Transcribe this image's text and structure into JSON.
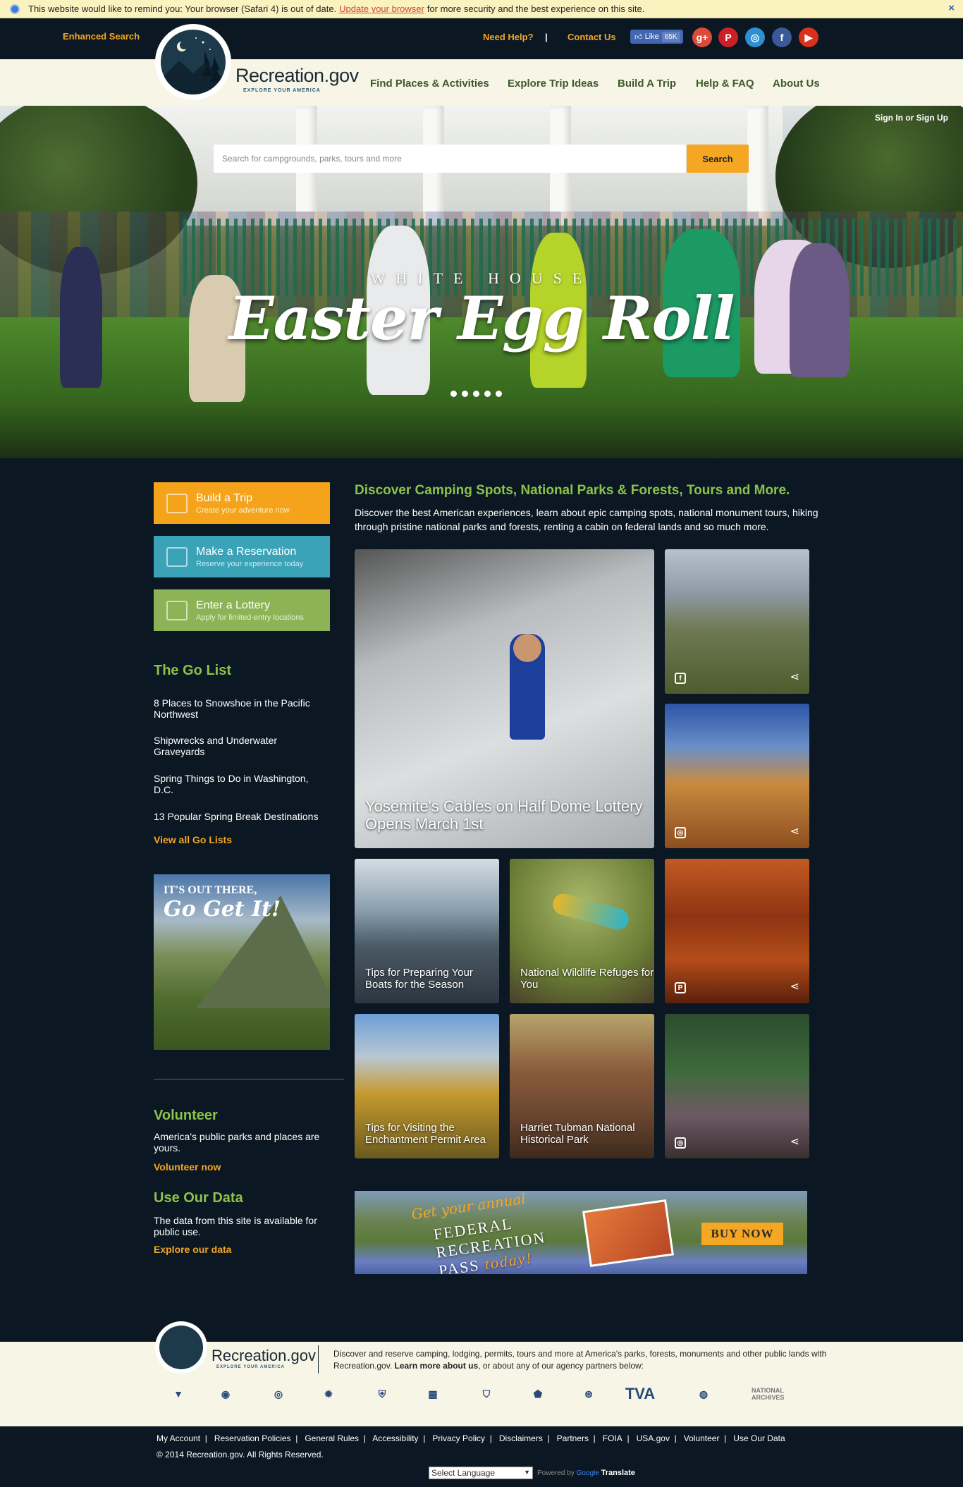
{
  "warning": {
    "prefix": "This website would like to remind you: Your browser (Safari 4) is out of date.",
    "link": "Update your browser",
    "suffix": "for more security and the best experience on this site.",
    "close": "×"
  },
  "util": {
    "enhanced_search": "Enhanced Search",
    "need_help": "Need Help?",
    "separator": "|",
    "contact": "Contact Us",
    "fb_like": "Like",
    "fb_count": "65K",
    "social_icons": [
      "google-plus",
      "pinterest",
      "instagram",
      "facebook",
      "youtube"
    ]
  },
  "logo": {
    "title": "Recreation.gov",
    "subtitle": "EXPLORE YOUR AMERICA"
  },
  "nav": {
    "items": [
      "Find Places & Activities",
      "Explore Trip Ideas",
      "Build A Trip",
      "Help & FAQ",
      "About Us"
    ]
  },
  "hero": {
    "search_placeholder": "Search for campgrounds, parks, tours and more",
    "search_button": "Search",
    "signin": "Sign In or Sign Up",
    "supertitle": "WHITE HOUSE",
    "title": "Easter Egg Roll",
    "slides": 5
  },
  "ctas": [
    {
      "title": "Build a Trip",
      "subtitle": "Create your adventure now",
      "color": "#f5a31b"
    },
    {
      "title": "Make a Reservation",
      "subtitle": "Reserve your experience today",
      "color": "#3ba3b8"
    },
    {
      "title": "Enter a Lottery",
      "subtitle": "Apply for limited-entry locations",
      "color": "#8cb456"
    }
  ],
  "golist": {
    "title": "The Go List",
    "items": [
      "8 Places to Snowshoe in the Pacific Northwest",
      "Shipwrecks and Underwater Graveyards",
      "Spring Things to Do in Washington, D.C.",
      "13 Popular Spring Break Destinations"
    ],
    "view_all": "View all Go Lists"
  },
  "promo": {
    "line1": "IT'S OUT THERE,",
    "line2": "Go Get It!"
  },
  "volunteer": {
    "title": "Volunteer",
    "text": "America's public parks and places are yours.",
    "link": "Volunteer now"
  },
  "data_section": {
    "title": "Use Our Data",
    "text": "The data from this site is available for public use.",
    "link": "Explore our data"
  },
  "discover": {
    "title": "Discover Camping Spots, National Parks & Forests, Tours and More.",
    "text": "Discover the best American experiences, learn about epic camping spots, national monument tours, hiking through pristine national parks and forests, renting a cabin on federal lands and so much more."
  },
  "tiles": {
    "featured": "Yosemite's Cables on Half Dome Lottery Opens March 1st",
    "boats": "Tips for Preparing Your Boats for the Season",
    "wildlife": "National Wildlife Refuges for You",
    "enchantment": "Tips for Visiting the Enchantment Permit Area",
    "tubman": "Harriet Tubman National Historical Park",
    "social_facebook": "f",
    "social_instagram": "◎",
    "social_pinterest": "P",
    "share": "⋖"
  },
  "banner": {
    "line1": "Get your annual",
    "line2a": "FEDERAL",
    "line2b": "RECREATION",
    "line2c": "PASS",
    "line3": "today!",
    "button": "BUY NOW"
  },
  "footer": {
    "title": "Recreation.gov",
    "subtitle": "EXPLORE YOUR AMERICA",
    "text_a": "Discover and reserve camping, lodging, permits, tours and more at America's parks, forests, monuments and other public lands with Recreation.gov.",
    "text_link": "Learn more about us",
    "text_b": ", or about any of our agency partners below:",
    "agencies": [
      "BLM",
      "BOR",
      "NOAA",
      "USDA",
      "USFS",
      "USACE",
      "FWS",
      "NPS",
      "TREAS",
      "TVA",
      "USGS",
      "NARA"
    ],
    "links": [
      "My Account",
      "Reservation Policies",
      "General Rules",
      "Accessibility",
      "Privacy Policy",
      "Disclaimers",
      "Partners",
      "FOIA",
      "USA.gov",
      "Volunteer",
      "Use Our Data"
    ],
    "copyright": "© 2014 Recreation.gov. All Rights Reserved.",
    "language": "Select Language",
    "powered": "Powered by",
    "google": "Google",
    "translate": "Translate"
  }
}
